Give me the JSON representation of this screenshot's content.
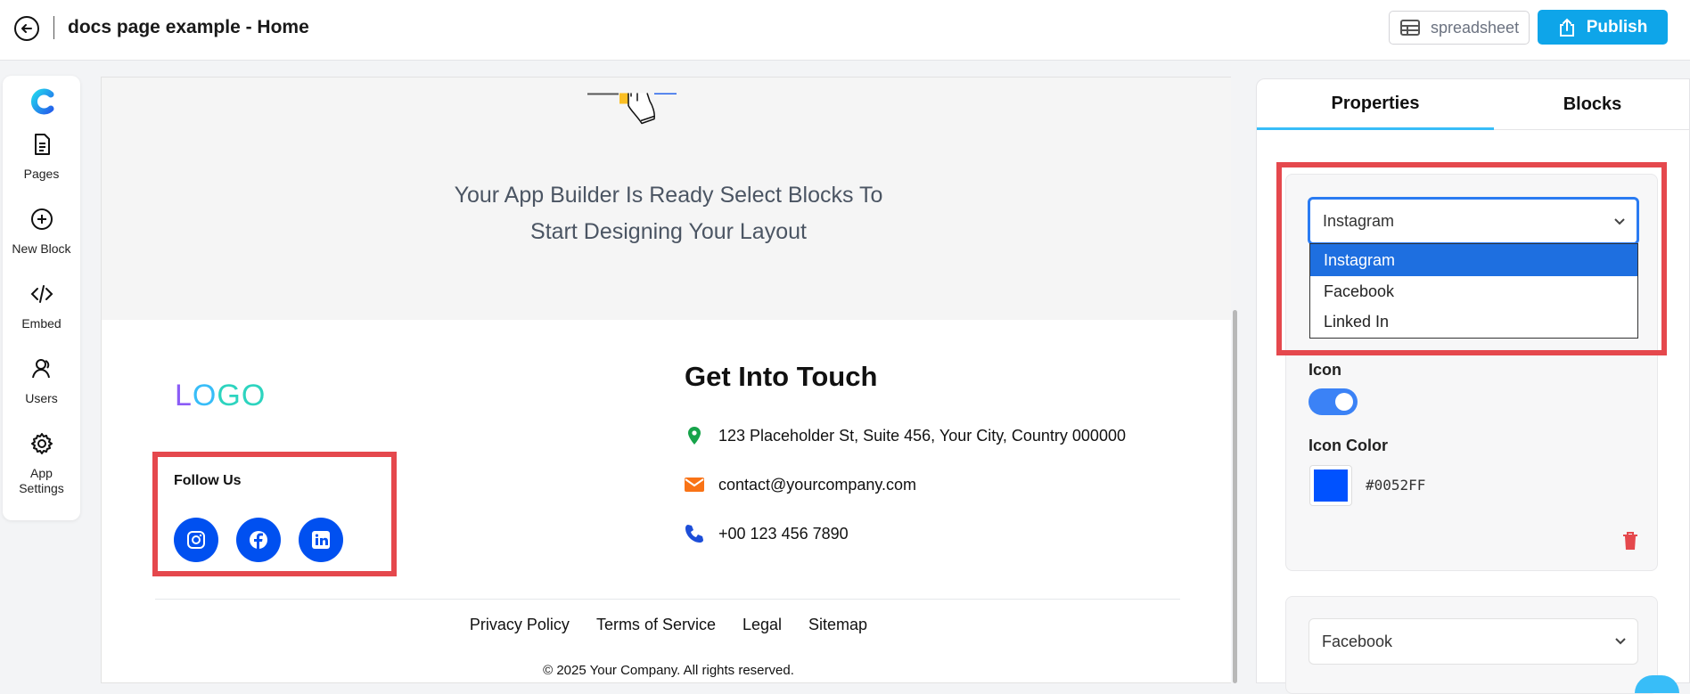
{
  "header": {
    "title": "docs page example - Home",
    "spreadsheet_label": "spreadsheet",
    "publish_label": "Publish"
  },
  "sidebar": {
    "items": [
      {
        "label": "Pages",
        "icon": "file-icon"
      },
      {
        "label": "New Block",
        "icon": "plus-circle-icon"
      },
      {
        "label": "Embed",
        "icon": "code-icon"
      },
      {
        "label": "Users",
        "icon": "users-icon"
      },
      {
        "label": "App\nSettings",
        "icon": "gear-icon"
      }
    ]
  },
  "canvas": {
    "hero_line1": "Your App Builder Is Ready Select Blocks To",
    "hero_line2": "Start Designing Your Layout",
    "logo": {
      "l": "L",
      "o": "O",
      "go": "GO"
    },
    "follow_title": "Follow Us",
    "contact_title": "Get Into Touch",
    "address": "123 Placeholder St, Suite 456, Your City, Country 000000",
    "email": "contact@yourcompany.com",
    "phone": "+00 123 456 7890",
    "footer_links": [
      "Privacy Policy",
      "Terms of Service",
      "Legal",
      "Sitemap"
    ],
    "copyright": "© 2025 Your Company. All rights reserved."
  },
  "panel": {
    "tabs": [
      "Properties",
      "Blocks"
    ],
    "social_select": {
      "value": "Instagram",
      "options": [
        "Instagram",
        "Facebook",
        "Linked In"
      ]
    },
    "icon_label": "Icon",
    "icon_color_label": "Icon Color",
    "icon_color": "#0052FF",
    "second_select": "Facebook"
  },
  "colors": {
    "publish": "#0ea5e9",
    "social_icon_bg": "#0050f0",
    "highlight": "#e5484d"
  }
}
